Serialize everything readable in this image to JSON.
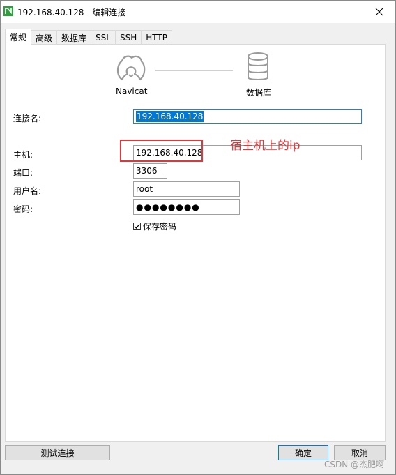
{
  "window": {
    "title": "192.168.40.128 - 编辑连接",
    "close_glyph": "✕"
  },
  "tabs": [
    {
      "label": "常规",
      "active": true
    },
    {
      "label": "高级",
      "active": false
    },
    {
      "label": "数据库",
      "active": false
    },
    {
      "label": "SSL",
      "active": false
    },
    {
      "label": "SSH",
      "active": false
    },
    {
      "label": "HTTP",
      "active": false
    }
  ],
  "diagram": {
    "left_label": "Navicat",
    "right_label": "数据库"
  },
  "form": {
    "connection_name_label": "连接名:",
    "connection_name_value": "192.168.40.128",
    "host_label": "主机:",
    "host_value": "192.168.40.128",
    "port_label": "端口:",
    "port_value": "3306",
    "username_label": "用户名:",
    "username_value": "root",
    "password_label": "密码:",
    "password_value": "●●●●●●●●",
    "save_password_label": "保存密码",
    "save_password_checked": true
  },
  "annotation": {
    "text": "宿主机上的ip",
    "color": "#e0373a"
  },
  "buttons": {
    "test": "测试连接",
    "ok": "确定",
    "cancel": "取消"
  },
  "watermark": "CSDN @杰肥啊",
  "colors": {
    "accent": "#0078d7",
    "focus_border": "#2a7ad6",
    "highlight": "#e0373a"
  }
}
